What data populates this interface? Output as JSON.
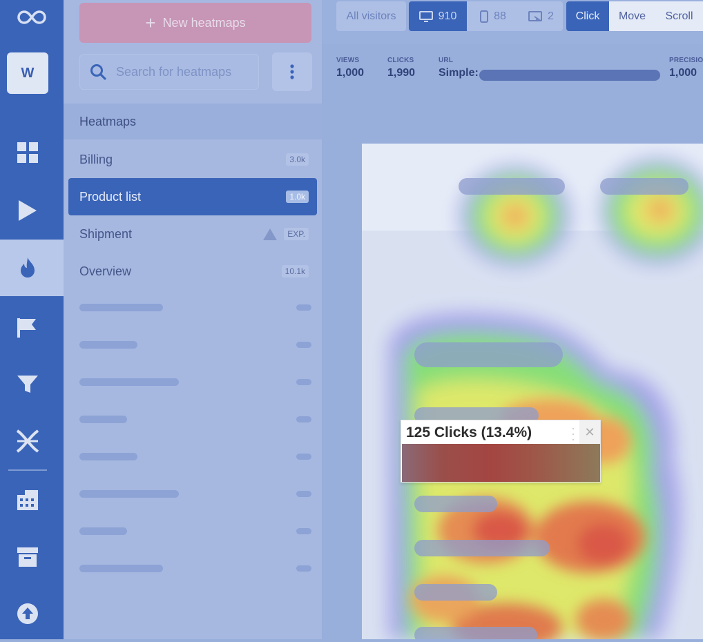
{
  "app": {
    "workspace_initial": "W",
    "icons": {
      "logo": "infinity-logo-icon",
      "rail": [
        "dashboard-icon",
        "play-icon",
        "flame-icon",
        "flag-icon",
        "funnel-icon",
        "forms-icon",
        "building-icon",
        "archive-icon",
        "upload-icon"
      ]
    }
  },
  "sidebar": {
    "new_button_label": "New heatmaps",
    "search_placeholder": "Search for heatmaps",
    "section_title": "Heatmaps",
    "items": [
      {
        "label": "Billing",
        "badge": "3.0k"
      },
      {
        "label": "Product list",
        "badge": "1.0k"
      },
      {
        "label": "Shipment",
        "badge": "EXP."
      },
      {
        "label": "Overview",
        "badge": "10.1k"
      }
    ]
  },
  "toolbar": {
    "visitors_label": "All visitors",
    "desktop_count": "910",
    "mobile_count": "88",
    "tablet_count": "2",
    "modes": [
      "Click",
      "Move",
      "Scroll"
    ],
    "active_mode": "Click"
  },
  "stats": {
    "views_label": "VIEWS",
    "views_value": "1,000",
    "clicks_label": "CLICKS",
    "clicks_value": "1,990",
    "url_label": "URL",
    "url_value": "Simple:",
    "precision_label": "PRECISIO",
    "precision_value": "1,000"
  },
  "tooltip": {
    "text": "125 Clicks (13.4%)"
  },
  "colors": {
    "primary": "#3a64b8",
    "rail": "#3a64b8",
    "overlay": "#98aedb"
  }
}
